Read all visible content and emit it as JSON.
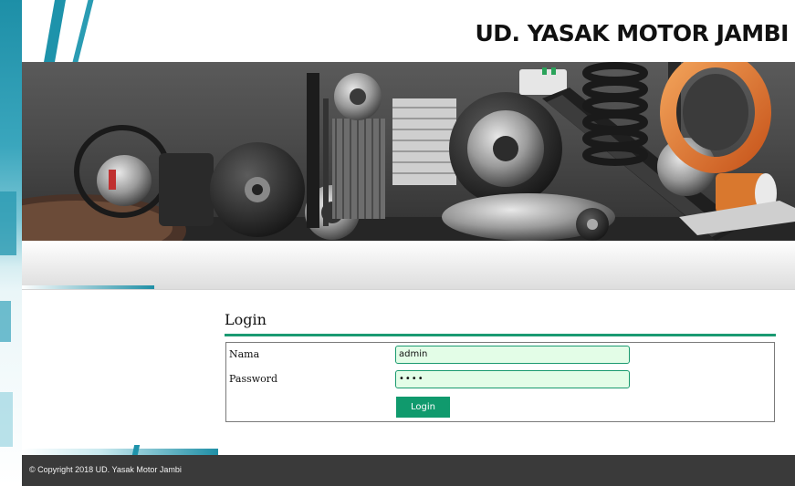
{
  "header": {
    "site_title": "UD. YASAK MOTOR JAMBI"
  },
  "banner": {
    "image_icon": "auto-parts-banner"
  },
  "login": {
    "title": "Login",
    "nama_label": "Nama",
    "nama_value": "admin",
    "password_label": "Password",
    "password_value": "••••",
    "button_label": "Login"
  },
  "footer": {
    "copyright": "© Copyright 2018 UD. Yasak Motor Jambi"
  },
  "colors": {
    "accent_green": "#109a6d",
    "input_bg": "#e3fde7",
    "teal_deco": "#1e93ab",
    "footer_bg": "#3a3a3a"
  }
}
